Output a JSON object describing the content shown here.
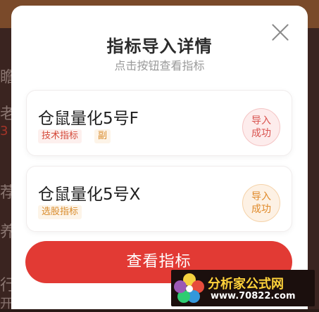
{
  "background": {
    "fragments": [
      "瞻",
      "老",
      "3",
      "荐",
      "养",
      "行",
      "开展撞外人员撞因劳住"
    ]
  },
  "dialog": {
    "title": "指标导入详情",
    "subtitle": "点击按钮查看指标",
    "items": [
      {
        "name": "仓鼠量化5号F",
        "tags": [
          "技术指标",
          "副"
        ],
        "status": [
          "导入",
          "成功"
        ],
        "status_color": "#d9534f"
      },
      {
        "name": "仓鼠量化5号X",
        "tags": [
          "选股指标"
        ],
        "status": [
          "导入",
          "成功"
        ],
        "status_color": "#e08a2a"
      }
    ],
    "button_label": "查看指标"
  },
  "watermark": {
    "text": "分析家公式网",
    "url": "www.70822.com"
  },
  "colors": {
    "accent": "#e23a34",
    "tag_red": "#d44a3a",
    "tag_orange": "#d98b2b"
  }
}
